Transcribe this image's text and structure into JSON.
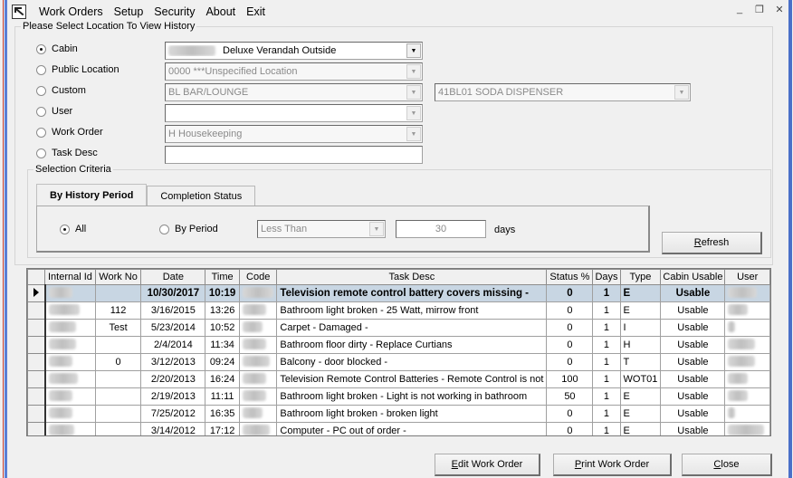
{
  "window": {
    "menu": [
      "Work Orders",
      "Setup",
      "Security",
      "About",
      "Exit"
    ],
    "controls": {
      "minimize": "_",
      "restore": "❐",
      "close": "✕"
    }
  },
  "location_group": {
    "legend": "Please Select Location To View History",
    "options": [
      {
        "label": "Cabin",
        "selected": true,
        "combo_value": "Deluxe Verandah Outside",
        "combo_prefix_blurred": true,
        "enabled": true
      },
      {
        "label": "Public Location",
        "selected": false,
        "combo_value": "0000  ***Unspecified Location",
        "enabled": false
      },
      {
        "label": "Custom",
        "selected": false,
        "combo_value": "BL  BAR/LOUNGE",
        "enabled": false,
        "secondary_combo_value": "41BL01  SODA DISPENSER"
      },
      {
        "label": "User",
        "selected": false,
        "combo_value": "",
        "enabled": false
      },
      {
        "label": "Work Order",
        "selected": false,
        "combo_value": "H Housekeeping",
        "enabled": false
      },
      {
        "label": "Task Desc",
        "selected": false,
        "text_value": ""
      }
    ]
  },
  "selection_criteria": {
    "legend": "Selection Criteria",
    "tabs": [
      {
        "label": "By History Period",
        "active": true
      },
      {
        "label": "Completion Status",
        "active": false
      }
    ],
    "all_label": "All",
    "all_selected": true,
    "by_period_label": "By Period",
    "by_period_selected": false,
    "comparison_value": "Less Than",
    "days_value": "30",
    "days_label": "days",
    "refresh_label": "Refresh",
    "refresh_mnemonic": "R"
  },
  "grid": {
    "columns": [
      "",
      "Internal Id",
      "Work No",
      "Date",
      "Time",
      "Code",
      "Task Desc",
      "Status %",
      "Days",
      "Type",
      "Cabin Usable",
      "User"
    ],
    "rows": [
      {
        "selected": true,
        "work_no": "",
        "date": "10/30/2017",
        "time": "10:19",
        "task_desc": "Television remote control battery covers missing -",
        "status": "0",
        "days": "1",
        "type": "E",
        "cabin_usable": "Usable"
      },
      {
        "selected": false,
        "work_no": "112",
        "date": "3/16/2015",
        "time": "13:26",
        "task_desc": "Bathroom light broken - 25 Watt, mirrow front",
        "status": "0",
        "days": "1",
        "type": "E",
        "cabin_usable": "Usable"
      },
      {
        "selected": false,
        "work_no": "Test",
        "date": "5/23/2014",
        "time": "10:52",
        "task_desc": "Carpet - Damaged -",
        "status": "0",
        "days": "1",
        "type": "I",
        "cabin_usable": "Usable"
      },
      {
        "selected": false,
        "work_no": "",
        "date": "2/4/2014",
        "time": "11:34",
        "task_desc": "Bathroom floor dirty - Replace Curtians",
        "status": "0",
        "days": "1",
        "type": "H",
        "cabin_usable": "Usable"
      },
      {
        "selected": false,
        "work_no": "0",
        "date": "3/12/2013",
        "time": "09:24",
        "task_desc": "Balcony - door blocked -",
        "status": "0",
        "days": "1",
        "type": "T",
        "cabin_usable": "Usable"
      },
      {
        "selected": false,
        "work_no": "",
        "date": "2/20/2013",
        "time": "16:24",
        "task_desc": "Television Remote Control Batteries - Remote Control is not",
        "status": "100",
        "days": "1",
        "type": "WOT01",
        "cabin_usable": "Usable"
      },
      {
        "selected": false,
        "work_no": "",
        "date": "2/19/2013",
        "time": "11:11",
        "task_desc": "Bathroom light broken - Light is not working in bathroom",
        "status": "50",
        "days": "1",
        "type": "E",
        "cabin_usable": "Usable"
      },
      {
        "selected": false,
        "work_no": "",
        "date": "7/25/2012",
        "time": "16:35",
        "task_desc": "Bathroom light broken - broken light",
        "status": "0",
        "days": "1",
        "type": "E",
        "cabin_usable": "Usable"
      },
      {
        "selected": false,
        "work_no": "",
        "date": "3/14/2012",
        "time": "17:12",
        "task_desc": "Computer - PC out of order -",
        "status": "0",
        "days": "1",
        "type": "E",
        "cabin_usable": "Usable"
      }
    ],
    "redacted_columns": [
      "Internal Id",
      "Code",
      "User"
    ]
  },
  "footer": {
    "buttons": [
      {
        "label": "Edit Work Order",
        "mnemonic": "E"
      },
      {
        "label": "Print Work Order",
        "mnemonic": "P"
      },
      {
        "label": "Close",
        "mnemonic": "C"
      }
    ]
  }
}
